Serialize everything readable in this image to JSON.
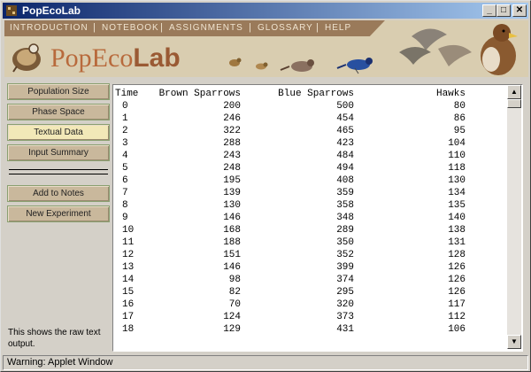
{
  "window": {
    "title": "PopEcoLab"
  },
  "title_buttons": {
    "minimize": "_",
    "maximize": "□",
    "close": "✕"
  },
  "menu": [
    "INTRODUCTION",
    "NOTEBOOK",
    "ASSIGNMENTS",
    "GLOSSARY",
    "HELP"
  ],
  "logo": {
    "part1": "PopEco",
    "part2": "Lab"
  },
  "sidebar": {
    "buttons": [
      "Population Size",
      "Phase Space",
      "Textual Data",
      "Input Summary"
    ],
    "active_index": 2,
    "actions": [
      "Add to Notes",
      "New Experiment"
    ],
    "help_text": "This shows the raw text output."
  },
  "table": {
    "headers": [
      "Time",
      "Brown Sparrows",
      "Blue Sparrows",
      "Hawks"
    ],
    "rows": [
      [
        "0",
        "200",
        "500",
        "80"
      ],
      [
        "1",
        "246",
        "454",
        "86"
      ],
      [
        "2",
        "322",
        "465",
        "95"
      ],
      [
        "3",
        "288",
        "423",
        "104"
      ],
      [
        "4",
        "243",
        "484",
        "110"
      ],
      [
        "5",
        "248",
        "494",
        "118"
      ],
      [
        "6",
        "195",
        "408",
        "130"
      ],
      [
        "7",
        "139",
        "359",
        "134"
      ],
      [
        "8",
        "130",
        "358",
        "135"
      ],
      [
        "9",
        "146",
        "348",
        "140"
      ],
      [
        "10",
        "168",
        "289",
        "138"
      ],
      [
        "11",
        "188",
        "350",
        "131"
      ],
      [
        "12",
        "151",
        "352",
        "128"
      ],
      [
        "13",
        "146",
        "399",
        "126"
      ],
      [
        "14",
        "98",
        "374",
        "126"
      ],
      [
        "15",
        "82",
        "295",
        "126"
      ],
      [
        "16",
        "70",
        "320",
        "117"
      ],
      [
        "17",
        "124",
        "373",
        "112"
      ],
      [
        "18",
        "129",
        "431",
        "106"
      ]
    ]
  },
  "scrollbar": {
    "up": "▲",
    "down": "▼"
  },
  "status": "Warning: Applet Window",
  "colors": {
    "title_start": "#0a246a",
    "banner": "#d9cdb0",
    "menu_bg": "#9a7a5a",
    "button": "#c9b89c",
    "button_active": "#f2e8b8",
    "logo": "#b86a3c"
  },
  "icons": [
    "app-icon",
    "minimize-icon",
    "maximize-icon",
    "close-icon",
    "logo-icon",
    "scroll-up-icon",
    "scroll-down-icon"
  ]
}
